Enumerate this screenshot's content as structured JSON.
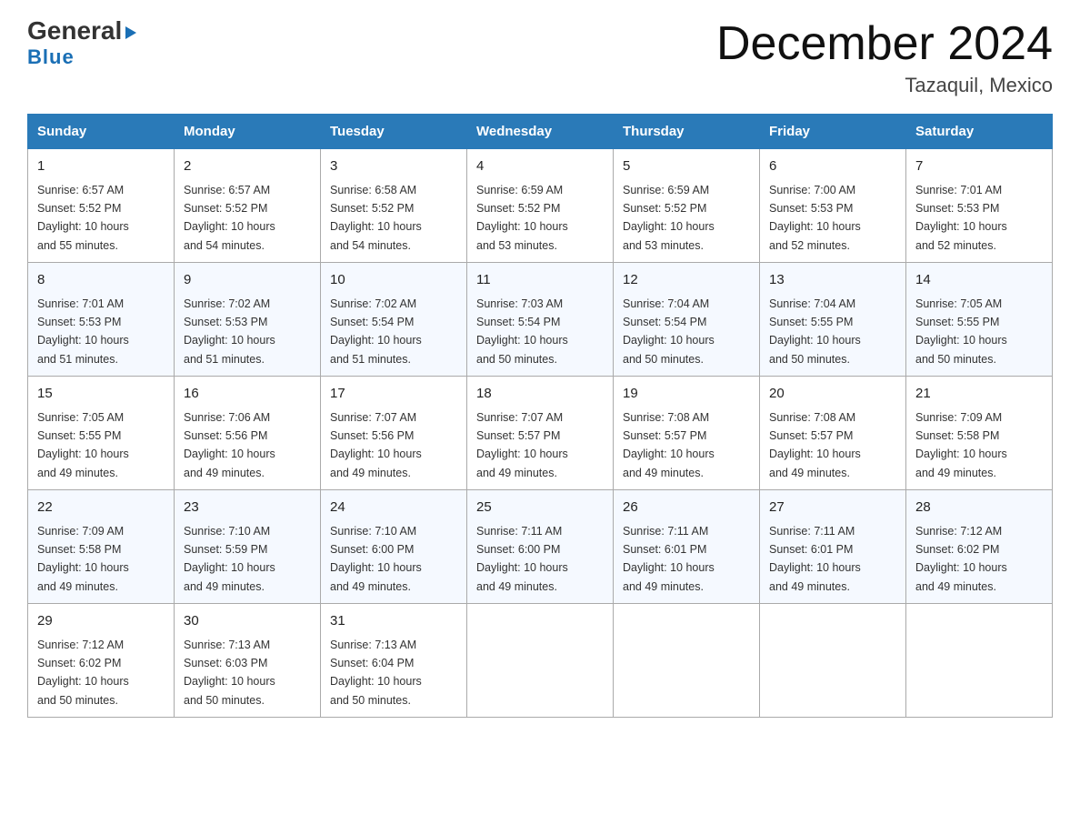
{
  "logo": {
    "general": "General",
    "blue": "Blue",
    "arrow_char": "▶"
  },
  "header": {
    "title": "December 2024",
    "subtitle": "Tazaquil, Mexico"
  },
  "days_of_week": [
    "Sunday",
    "Monday",
    "Tuesday",
    "Wednesday",
    "Thursday",
    "Friday",
    "Saturday"
  ],
  "weeks": [
    [
      {
        "day": "1",
        "sunrise": "6:57 AM",
        "sunset": "5:52 PM",
        "daylight": "10 hours and 55 minutes."
      },
      {
        "day": "2",
        "sunrise": "6:57 AM",
        "sunset": "5:52 PM",
        "daylight": "10 hours and 54 minutes."
      },
      {
        "day": "3",
        "sunrise": "6:58 AM",
        "sunset": "5:52 PM",
        "daylight": "10 hours and 54 minutes."
      },
      {
        "day": "4",
        "sunrise": "6:59 AM",
        "sunset": "5:52 PM",
        "daylight": "10 hours and 53 minutes."
      },
      {
        "day": "5",
        "sunrise": "6:59 AM",
        "sunset": "5:52 PM",
        "daylight": "10 hours and 53 minutes."
      },
      {
        "day": "6",
        "sunrise": "7:00 AM",
        "sunset": "5:53 PM",
        "daylight": "10 hours and 52 minutes."
      },
      {
        "day": "7",
        "sunrise": "7:01 AM",
        "sunset": "5:53 PM",
        "daylight": "10 hours and 52 minutes."
      }
    ],
    [
      {
        "day": "8",
        "sunrise": "7:01 AM",
        "sunset": "5:53 PM",
        "daylight": "10 hours and 51 minutes."
      },
      {
        "day": "9",
        "sunrise": "7:02 AM",
        "sunset": "5:53 PM",
        "daylight": "10 hours and 51 minutes."
      },
      {
        "day": "10",
        "sunrise": "7:02 AM",
        "sunset": "5:54 PM",
        "daylight": "10 hours and 51 minutes."
      },
      {
        "day": "11",
        "sunrise": "7:03 AM",
        "sunset": "5:54 PM",
        "daylight": "10 hours and 50 minutes."
      },
      {
        "day": "12",
        "sunrise": "7:04 AM",
        "sunset": "5:54 PM",
        "daylight": "10 hours and 50 minutes."
      },
      {
        "day": "13",
        "sunrise": "7:04 AM",
        "sunset": "5:55 PM",
        "daylight": "10 hours and 50 minutes."
      },
      {
        "day": "14",
        "sunrise": "7:05 AM",
        "sunset": "5:55 PM",
        "daylight": "10 hours and 50 minutes."
      }
    ],
    [
      {
        "day": "15",
        "sunrise": "7:05 AM",
        "sunset": "5:55 PM",
        "daylight": "10 hours and 49 minutes."
      },
      {
        "day": "16",
        "sunrise": "7:06 AM",
        "sunset": "5:56 PM",
        "daylight": "10 hours and 49 minutes."
      },
      {
        "day": "17",
        "sunrise": "7:07 AM",
        "sunset": "5:56 PM",
        "daylight": "10 hours and 49 minutes."
      },
      {
        "day": "18",
        "sunrise": "7:07 AM",
        "sunset": "5:57 PM",
        "daylight": "10 hours and 49 minutes."
      },
      {
        "day": "19",
        "sunrise": "7:08 AM",
        "sunset": "5:57 PM",
        "daylight": "10 hours and 49 minutes."
      },
      {
        "day": "20",
        "sunrise": "7:08 AM",
        "sunset": "5:57 PM",
        "daylight": "10 hours and 49 minutes."
      },
      {
        "day": "21",
        "sunrise": "7:09 AM",
        "sunset": "5:58 PM",
        "daylight": "10 hours and 49 minutes."
      }
    ],
    [
      {
        "day": "22",
        "sunrise": "7:09 AM",
        "sunset": "5:58 PM",
        "daylight": "10 hours and 49 minutes."
      },
      {
        "day": "23",
        "sunrise": "7:10 AM",
        "sunset": "5:59 PM",
        "daylight": "10 hours and 49 minutes."
      },
      {
        "day": "24",
        "sunrise": "7:10 AM",
        "sunset": "6:00 PM",
        "daylight": "10 hours and 49 minutes."
      },
      {
        "day": "25",
        "sunrise": "7:11 AM",
        "sunset": "6:00 PM",
        "daylight": "10 hours and 49 minutes."
      },
      {
        "day": "26",
        "sunrise": "7:11 AM",
        "sunset": "6:01 PM",
        "daylight": "10 hours and 49 minutes."
      },
      {
        "day": "27",
        "sunrise": "7:11 AM",
        "sunset": "6:01 PM",
        "daylight": "10 hours and 49 minutes."
      },
      {
        "day": "28",
        "sunrise": "7:12 AM",
        "sunset": "6:02 PM",
        "daylight": "10 hours and 49 minutes."
      }
    ],
    [
      {
        "day": "29",
        "sunrise": "7:12 AM",
        "sunset": "6:02 PM",
        "daylight": "10 hours and 50 minutes."
      },
      {
        "day": "30",
        "sunrise": "7:13 AM",
        "sunset": "6:03 PM",
        "daylight": "10 hours and 50 minutes."
      },
      {
        "day": "31",
        "sunrise": "7:13 AM",
        "sunset": "6:04 PM",
        "daylight": "10 hours and 50 minutes."
      },
      null,
      null,
      null,
      null
    ]
  ],
  "labels": {
    "sunrise": "Sunrise: ",
    "sunset": "Sunset: ",
    "daylight": "Daylight: "
  },
  "colors": {
    "header_bg": "#2a7ab8",
    "header_text": "#ffffff",
    "accent_blue": "#1a6fb5"
  }
}
